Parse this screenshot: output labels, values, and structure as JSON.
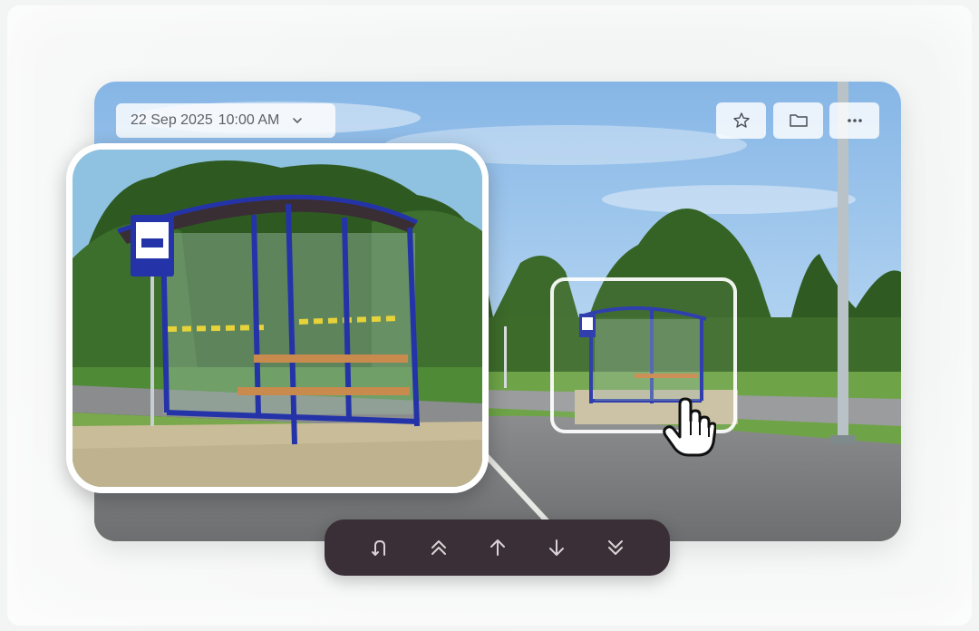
{
  "viewer": {
    "date": "22 Sep 2025",
    "time": "10:00 AM"
  },
  "actions": {
    "icons": [
      "star-icon",
      "folder-icon",
      "more-icon"
    ]
  },
  "toolbar": {
    "icons": [
      "undo-icon",
      "double-chevron-up-icon",
      "arrow-up-icon",
      "arrow-down-icon",
      "double-chevron-down-icon"
    ],
    "icon_color": "#d9d3d6",
    "background": "#3a2f36"
  },
  "colors": {
    "shelter_frame": "#2434a8",
    "bench": "#c98a4e",
    "sky": "#9cc6ec",
    "grass": "#5e9a3a"
  }
}
